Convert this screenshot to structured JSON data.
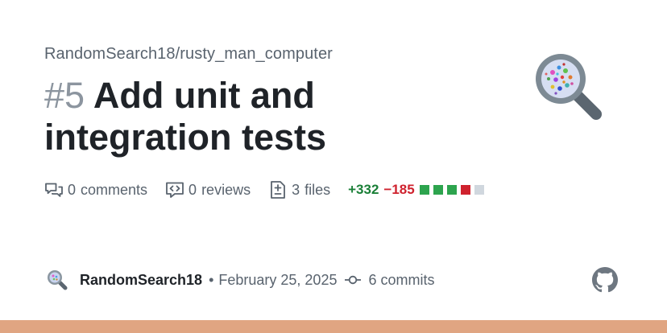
{
  "repo": {
    "path": "RandomSearch18/rusty_man_computer"
  },
  "pull_request": {
    "number": "#5",
    "title": "Add unit and integration tests"
  },
  "stats": {
    "comments_count": "0",
    "comments_label": "comments",
    "reviews_count": "0",
    "reviews_label": "reviews",
    "files_count": "3",
    "files_label": "files",
    "additions": "+332",
    "deletions": "−185",
    "diff_blocks": [
      "green",
      "green",
      "green",
      "red",
      "gray"
    ]
  },
  "author": {
    "name": "RandomSearch18",
    "separator": "•",
    "date": "February 25, 2025",
    "commits": "6 commits"
  },
  "icons": {
    "comments": "comment-discussion-icon",
    "reviews": "code-review-icon",
    "files": "file-diff-icon",
    "commits": "git-commit-icon",
    "logo": "github-mark-icon",
    "avatar": "magnifying-glass-avatar"
  },
  "colors": {
    "text_primary": "#1f2328",
    "text_muted": "#59636e",
    "additions": "#1a7f37",
    "deletions": "#cf222e",
    "block_green": "#2da44e",
    "block_red": "#cf222e",
    "block_gray": "#d0d7de",
    "bottom_bar": "#e0a582",
    "logo": "#6e7781"
  }
}
